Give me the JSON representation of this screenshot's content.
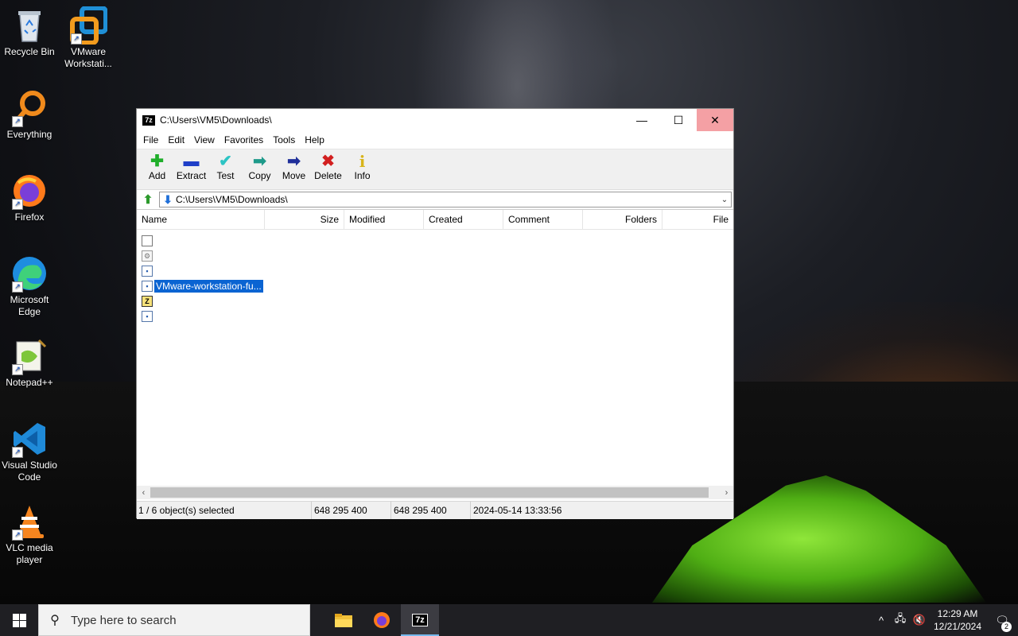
{
  "desktop": {
    "icons": [
      {
        "label": "Recycle Bin",
        "icon": "recycle-bin-icon"
      },
      {
        "label": "VMware Workstati...",
        "icon": "vmware-icon"
      },
      {
        "label": "Everything",
        "icon": "everything-icon"
      },
      {
        "label": "Firefox",
        "icon": "firefox-icon"
      },
      {
        "label": "Microsoft Edge",
        "icon": "edge-icon"
      },
      {
        "label": "Notepad++",
        "icon": "notepadpp-icon"
      },
      {
        "label": "Visual Studio Code",
        "icon": "vscode-icon"
      },
      {
        "label": "VLC media player",
        "icon": "vlc-icon"
      }
    ]
  },
  "window": {
    "app_icon_text": "7z",
    "title": "C:\\Users\\VM5\\Downloads\\",
    "minimize": "—",
    "maximize": "☐",
    "close": "✕"
  },
  "menu": [
    "File",
    "Edit",
    "View",
    "Favorites",
    "Tools",
    "Help"
  ],
  "toolbar": [
    {
      "label": "Add",
      "glyph": "✚",
      "color": "#1fae2a"
    },
    {
      "label": "Extract",
      "glyph": "▬",
      "color": "#1f3fc8"
    },
    {
      "label": "Test",
      "glyph": "✔",
      "color": "#2cc4c4"
    },
    {
      "label": "Copy",
      "glyph": "➡",
      "color": "#1e9a8a"
    },
    {
      "label": "Move",
      "glyph": "➡",
      "color": "#1f2f9a"
    },
    {
      "label": "Delete",
      "glyph": "✖",
      "color": "#d21f1f"
    },
    {
      "label": "Info",
      "glyph": "i",
      "color": "#d8b41a"
    }
  ],
  "address": {
    "path": "C:\\Users\\VM5\\Downloads\\"
  },
  "columns": [
    "Name",
    "Size",
    "Modified",
    "Created",
    "Comment",
    "Folders",
    "File"
  ],
  "files": [
    {
      "name": "",
      "type": "document"
    },
    {
      "name": "",
      "type": "settings"
    },
    {
      "name": "",
      "type": "executable"
    },
    {
      "name": "VMware-workstation-fu...",
      "type": "executable",
      "selected": true
    },
    {
      "name": "",
      "type": "archive"
    },
    {
      "name": "",
      "type": "executable"
    }
  ],
  "status": {
    "selection": "1 / 6 object(s) selected",
    "size": "648 295 400",
    "packed_size": "648 295 400",
    "date": "2024-05-14 13:33:56"
  },
  "taskbar": {
    "search_placeholder": "Type here to search",
    "apps": [
      {
        "name": "file-explorer-icon",
        "active": false
      },
      {
        "name": "firefox-icon",
        "active": false
      },
      {
        "name": "7zip-icon",
        "active": true,
        "text": "7z"
      }
    ],
    "time": "12:29 AM",
    "date": "12/21/2024",
    "notification_count": "2"
  },
  "colors": {
    "selection": "#0a64d2",
    "close_hover": "#f4a0a4",
    "taskbar": "#1f1f23"
  }
}
